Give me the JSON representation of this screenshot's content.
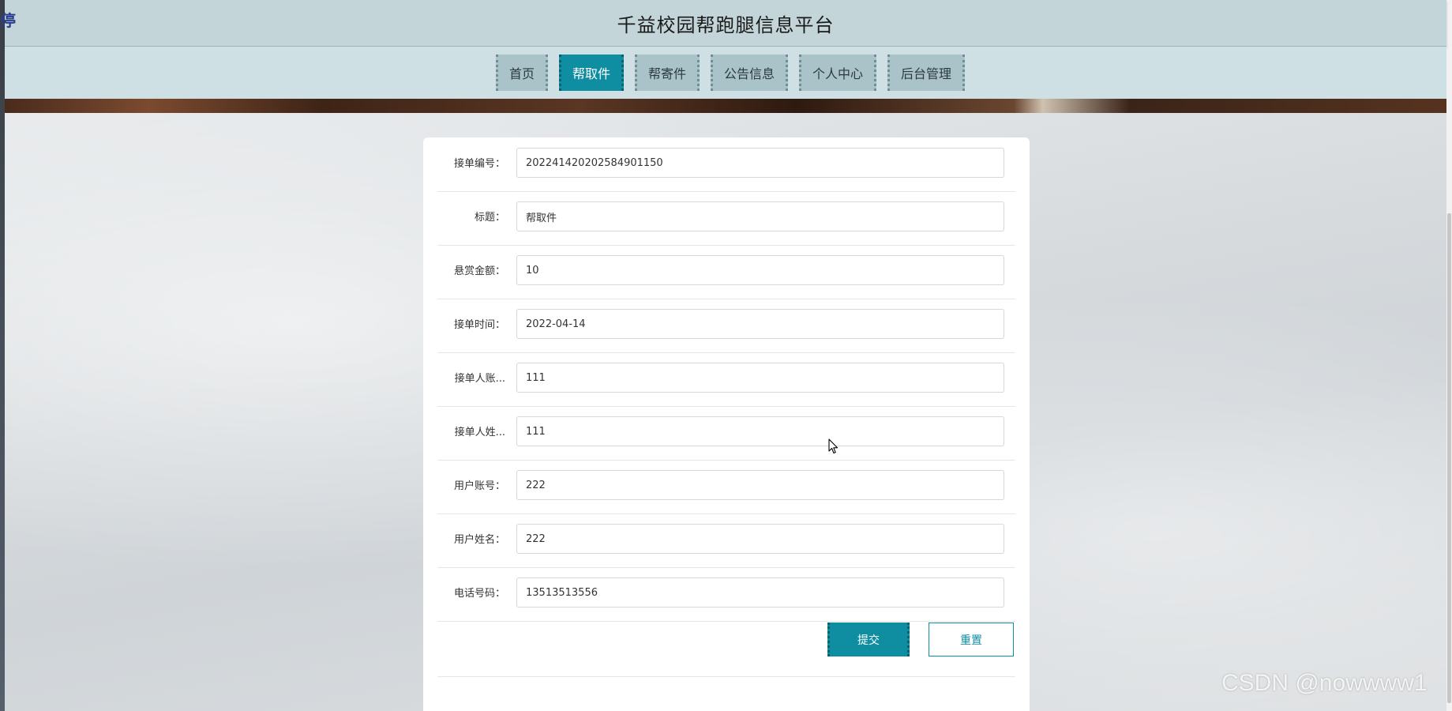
{
  "corner_glyph": "停",
  "header": {
    "title": "千益校园帮跑腿信息平台"
  },
  "nav": {
    "items": [
      {
        "label": "首页",
        "active": false
      },
      {
        "label": "帮取件",
        "active": true
      },
      {
        "label": "帮寄件",
        "active": false
      },
      {
        "label": "公告信息",
        "active": false
      },
      {
        "label": "个人中心",
        "active": false
      },
      {
        "label": "后台管理",
        "active": false
      }
    ]
  },
  "form": {
    "fields": [
      {
        "label": "接单编号：",
        "value": "202241420202584901150"
      },
      {
        "label": "标题：",
        "value": "帮取件"
      },
      {
        "label": "悬赏金额：",
        "value": "10"
      },
      {
        "label": "接单时间：",
        "value": "2022-04-14"
      },
      {
        "label": "接单人账...",
        "value": "111"
      },
      {
        "label": "接单人姓...",
        "value": "111"
      },
      {
        "label": "用户账号：",
        "value": "222"
      },
      {
        "label": "用户姓名：",
        "value": "222"
      },
      {
        "label": "电话号码：",
        "value": "13513513556"
      }
    ],
    "submit_label": "提交",
    "reset_label": "重置"
  },
  "watermark": "CSDN @nowwww1",
  "colors": {
    "accent": "#0f8da1",
    "header_bg": "#c3d5d9",
    "nav_bg": "#cfe0e5",
    "nav_item_bg": "#a9c3c8"
  }
}
